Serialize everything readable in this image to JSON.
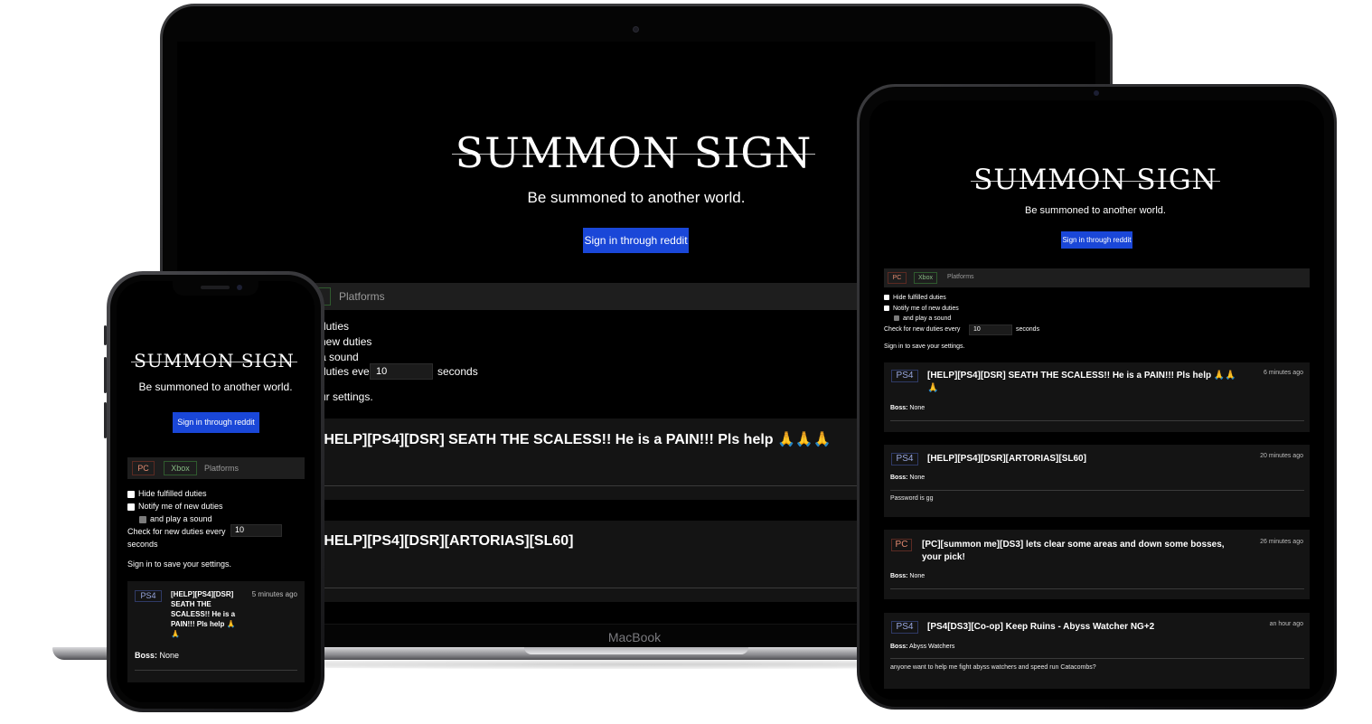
{
  "app": {
    "logo": "SUMMON SIGN",
    "tagline": "Be summoned to another world.",
    "signin_label": "Sign in through reddit"
  },
  "platforms": {
    "pc": "PC",
    "xbox": "Xbox",
    "label": "Platforms"
  },
  "settings": {
    "hide_fulfilled": "Hide fulfilled duties",
    "notify": "Notify me of new duties",
    "play_sound": "and play a sound",
    "check_prefix": "Check for new duties every",
    "check_value": "10",
    "check_suffix": "seconds",
    "save_note": "Sign in to save your settings."
  },
  "duties": [
    {
      "platform": "PS4",
      "title": "[HELP][PS4][DSR] SEATH THE SCALESS!! He is a PAIN!!! Pls help 🙏🙏🙏",
      "time": "6 minutes ago",
      "boss_label": "Boss:",
      "boss": "None",
      "description": ""
    },
    {
      "platform": "PS4",
      "title": "[HELP][PS4][DSR][ARTORIAS][SL60]",
      "time": "20 minutes ago",
      "boss_label": "Boss:",
      "boss": "None",
      "description": "Password is gg"
    },
    {
      "platform": "PC",
      "title": "[PC][summon me][DS3] lets clear some areas and down some bosses, your pick!",
      "time": "26 minutes ago",
      "boss_label": "Boss:",
      "boss": "None",
      "description": ""
    },
    {
      "platform": "PS4",
      "title": "[PS4[DS3][Co-op] Keep Ruins - Abyss Watcher NG+2",
      "time": "an hour ago",
      "boss_label": "Boss:",
      "boss": "Abyss Watchers",
      "description": "anyone want to help me fight abyss watchers and speed run Catacombs?"
    }
  ],
  "laptop": {
    "brand": "MacBook",
    "duty1_title_visible": "[HELP][PS4][DSR] SEATH THE SCALESS!! He is a PAIN!!! Pls help 🙏🙏🙏",
    "duty2_title_visible": "[HELP][PS4][DSR][ARTORIAS][SL60]",
    "settings_visible": {
      "line1": "duties",
      "line2": "new duties",
      "line3": "a sound",
      "line4": "duties every",
      "line5": "ur settings."
    }
  },
  "phone": {
    "duty_title": "[HELP][PS4][DSR] SEATH THE SCALESS!! He is a PAIN!!! Pls help 🙏🙏",
    "duty_time": "5 minutes ago"
  },
  "colors": {
    "background": "#000000",
    "accent_button": "#1a47d8",
    "card": "#141414",
    "platform_bar": "#1e1e1e"
  }
}
